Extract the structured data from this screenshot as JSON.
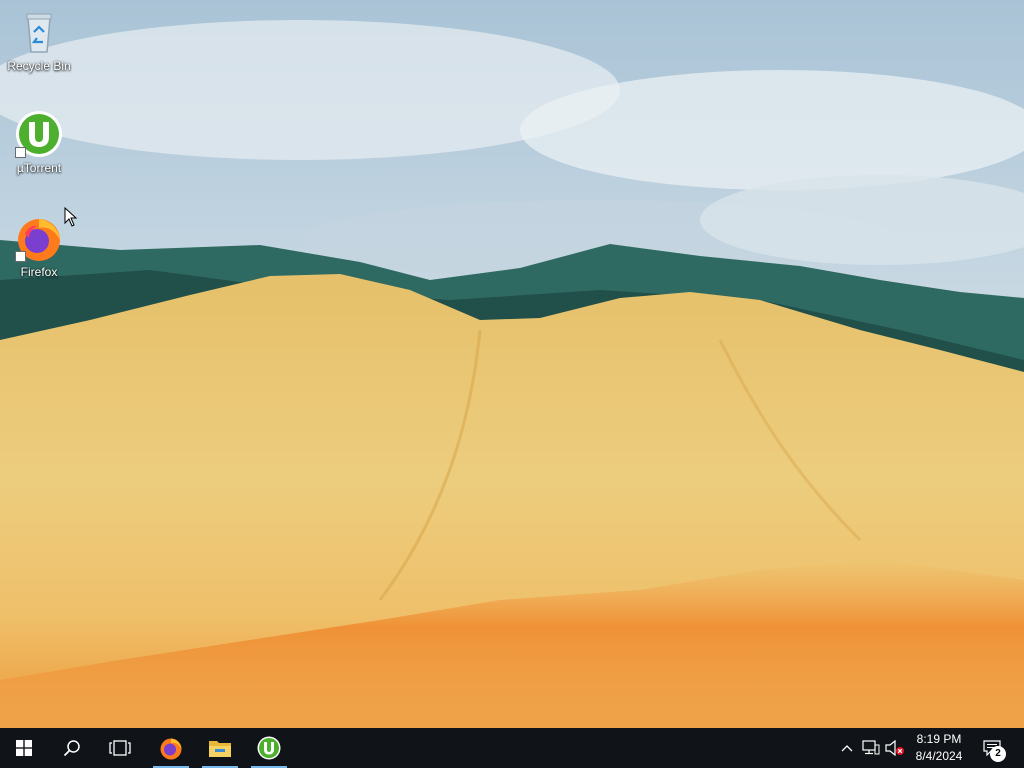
{
  "desktop": {
    "icons": [
      {
        "label": "Recycle Bin"
      },
      {
        "label": "µTorrent"
      },
      {
        "label": "Firefox"
      }
    ]
  },
  "taskbar": {
    "start_icon": "windows-logo-icon",
    "search_icon": "search-icon",
    "task_view_icon": "task-view-icon",
    "pinned": [
      {
        "name": "Firefox",
        "icon": "firefox-icon"
      },
      {
        "name": "File Explorer",
        "icon": "folder-icon"
      },
      {
        "name": "µTorrent",
        "icon": "utorrent-icon"
      }
    ],
    "tray": {
      "show_hidden_icon": "chevron-up-icon",
      "network_icon": "network-icon",
      "volume_icon": "volume-muted-icon",
      "time": "8:19 PM",
      "date": "8/4/2024",
      "notifications_count": "2"
    }
  },
  "colors": {
    "taskbar": "#101418",
    "accent_underline": "#76b9ed",
    "utorrent_green": "#4caf2e"
  }
}
